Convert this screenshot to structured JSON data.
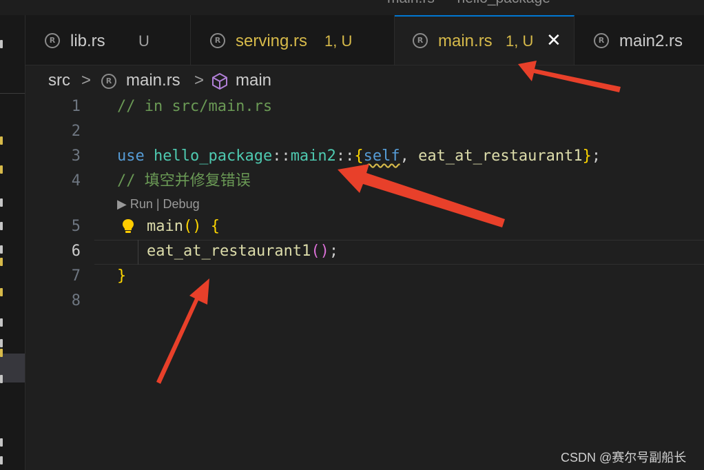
{
  "window": {
    "title": "main.rs — hello_package"
  },
  "tabs": [
    {
      "name": "lib.rs",
      "status": "U",
      "icon": "rust-icon",
      "active": false
    },
    {
      "name": "serving.rs",
      "status": "1, U",
      "icon": "rust-icon",
      "active": false
    },
    {
      "name": "main.rs",
      "status": "1, U",
      "icon": "rust-icon",
      "active": true
    },
    {
      "name": "main2.rs",
      "status": "",
      "icon": "rust-icon",
      "active": false
    }
  ],
  "breadcrumb": {
    "folder": "src",
    "file": "main.rs",
    "symbol": "main",
    "separator": ">"
  },
  "codelens": "▶ Run | Debug",
  "lines": {
    "n1": "1",
    "n2": "2",
    "n3": "3",
    "n4": "4",
    "n5": "5",
    "n6": "6",
    "n7": "7",
    "n8": "8",
    "l1": "// in src/main.rs",
    "l3_use": "use",
    "l3_pkg": "hello_package",
    "l3_sep1": "::",
    "l3_mod": "main2",
    "l3_sep2": "::",
    "l3_open": "{",
    "l3_self": "self",
    "l3_comma": ", ",
    "l3_fn": "eat_at_restaurant1",
    "l3_close": "}",
    "l3_semi": ";",
    "l4": "// 填空并修复错误",
    "l5_fn": "main",
    "l5_parens": "()",
    "l5_brace": "{",
    "l6_fn": "eat_at_restaurant1",
    "l6_parens": "()",
    "l6_semi": ";",
    "l7": "}"
  },
  "colors": {
    "accent": "#0078d4",
    "modified": "#d7ba4a",
    "annotation_arrow": "#e8402a"
  },
  "watermark": "CSDN @赛尔号副船长"
}
